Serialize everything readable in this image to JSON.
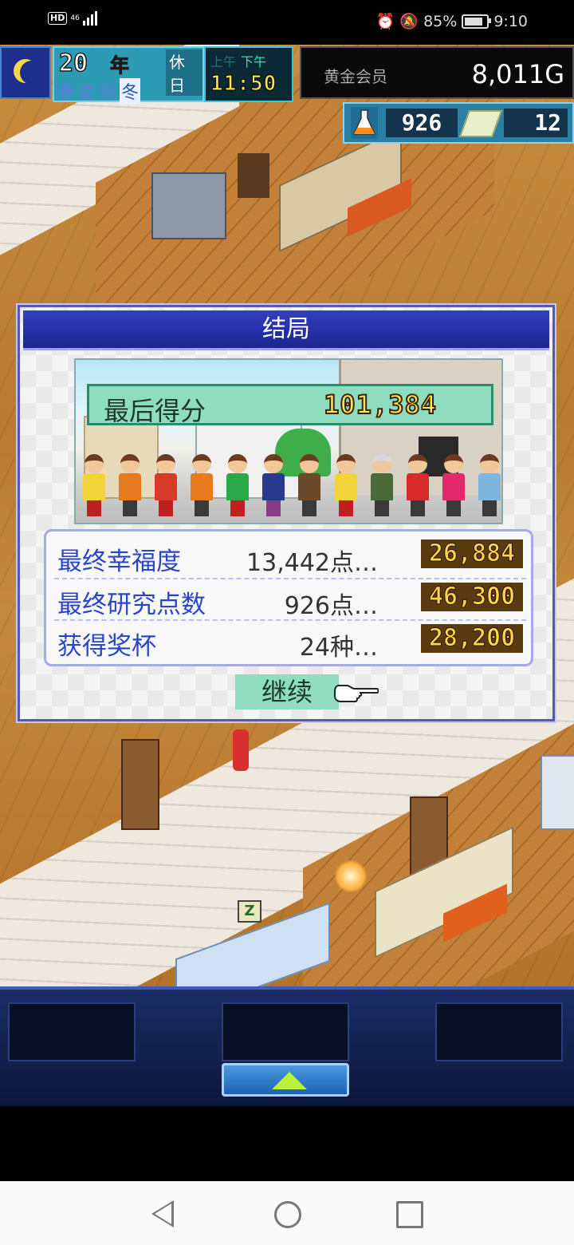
{
  "status_bar": {
    "hd": "HD",
    "network": "46",
    "battery": "85%",
    "time": "9:10",
    "icons": [
      "alarm-icon",
      "mute-icon",
      "battery-icon"
    ]
  },
  "hud": {
    "year": "20",
    "year_unit": "年",
    "holiday": "休日",
    "seasons": [
      "春",
      "夏",
      "秋",
      "冬"
    ],
    "active_season": "冬",
    "am": "上午",
    "pm": "下午",
    "time": "11:50",
    "membership": "黄金会员",
    "money": "8,011G",
    "research_points": "926",
    "tickets": "12"
  },
  "dialog": {
    "title": "结局",
    "final_score_label": "最后得分",
    "final_score": "101,384",
    "rows": [
      {
        "label": "最终幸福度",
        "value": "13,442点…",
        "points": "26,884"
      },
      {
        "label": "最终研究点数",
        "value": "926点…",
        "points": "46,300"
      },
      {
        "label": "获得奖杯",
        "value": "24种…",
        "points": "28,200"
      }
    ],
    "continue_label": "继续"
  },
  "colors": {
    "dialog_title_bg": "#2630a8",
    "stat_label": "#2b45c9",
    "score_yellow": "#ffe65a",
    "continue_bg": "#90dcc0"
  }
}
